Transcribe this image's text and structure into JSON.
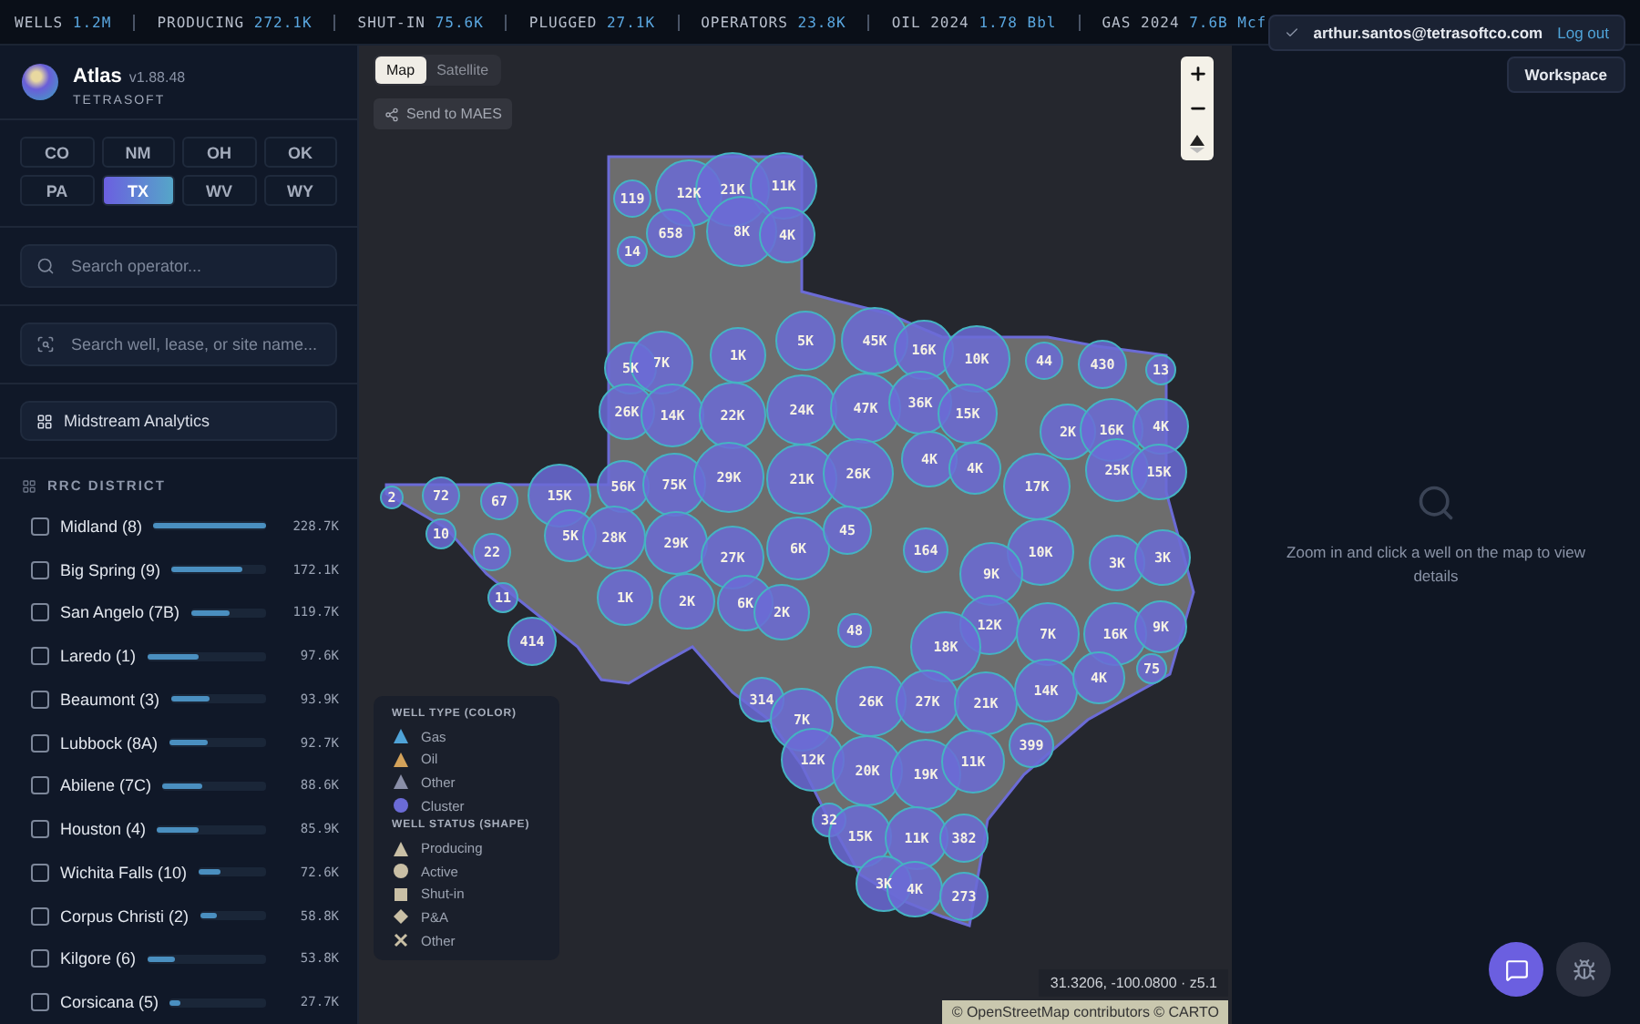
{
  "stats": [
    {
      "label": "WELLS",
      "value": "1.2M"
    },
    {
      "label": "PRODUCING",
      "value": "272.1K"
    },
    {
      "label": "SHUT-IN",
      "value": "75.6K"
    },
    {
      "label": "PLUGGED",
      "value": "27.1K"
    },
    {
      "label": "OPERATORS",
      "value": "23.8K"
    },
    {
      "label": "OIL 2024",
      "value": "1.78 Bbl"
    },
    {
      "label": "GAS 2024",
      "value": "7.6B Mcf"
    }
  ],
  "user": {
    "email": "arthur.santos@tetrasoftco.com",
    "logout": "Log out"
  },
  "workspace_button": "Workspace",
  "brand": {
    "name": "Atlas",
    "version": "v1.88.48",
    "company": "TETRASOFT"
  },
  "states": [
    {
      "label": "CO",
      "selected": false
    },
    {
      "label": "NM",
      "selected": false
    },
    {
      "label": "OH",
      "selected": false
    },
    {
      "label": "OK",
      "selected": false
    },
    {
      "label": "PA",
      "selected": false
    },
    {
      "label": "TX",
      "selected": true
    },
    {
      "label": "WV",
      "selected": false
    },
    {
      "label": "WY",
      "selected": false
    }
  ],
  "operator_search": {
    "placeholder": "Search operator..."
  },
  "site_search": {
    "placeholder": "Search well, lease, or site name..."
  },
  "midstream_button": "Midstream Analytics",
  "district_heading": "RRC DISTRICT",
  "districts": [
    {
      "name": "Midland (8)",
      "checked": false,
      "level": 1,
      "value": "228.7K"
    },
    {
      "name": "Big Spring (9)",
      "checked": false,
      "level": 0.75,
      "value": "172.1K"
    },
    {
      "name": "San Angelo (7B)",
      "checked": false,
      "level": 0.52,
      "value": "119.7K"
    },
    {
      "name": "Laredo (1)",
      "checked": false,
      "level": 0.43,
      "value": "97.6K"
    },
    {
      "name": "Beaumont (3)",
      "checked": false,
      "level": 0.41,
      "value": "93.9K"
    },
    {
      "name": "Lubbock (8A)",
      "checked": false,
      "level": 0.4,
      "value": "92.7K"
    },
    {
      "name": "Abilene (7C)",
      "checked": false,
      "level": 0.39,
      "value": "88.6K"
    },
    {
      "name": "Houston (4)",
      "checked": false,
      "level": 0.38,
      "value": "85.9K"
    },
    {
      "name": "Wichita Falls (10)",
      "checked": false,
      "level": 0.32,
      "value": "72.6K"
    },
    {
      "name": "Corpus Christi (2)",
      "checked": false,
      "level": 0.26,
      "value": "58.8K"
    },
    {
      "name": "Kilgore (6)",
      "checked": false,
      "level": 0.24,
      "value": "53.8K"
    },
    {
      "name": "Corsicana (5)",
      "checked": false,
      "level": 0.12,
      "value": "27.7K"
    }
  ],
  "map": {
    "view_modes": [
      {
        "label": "Map",
        "selected": true
      },
      {
        "label": "Satellite",
        "selected": false
      }
    ],
    "send_button": "Send to MAES",
    "clusters": [
      {
        "label": "119"
      },
      {
        "label": "12K"
      },
      {
        "label": "21K"
      },
      {
        "label": "11K"
      },
      {
        "label": "658"
      },
      {
        "label": "8K"
      },
      {
        "label": "4K"
      },
      {
        "label": "14"
      },
      {
        "label": "5K"
      },
      {
        "label": "7K"
      },
      {
        "label": "1K"
      },
      {
        "label": "5K"
      },
      {
        "label": "45K"
      },
      {
        "label": "16K"
      },
      {
        "label": "10K"
      },
      {
        "label": "44"
      },
      {
        "label": "430"
      },
      {
        "label": "13"
      },
      {
        "label": "26K"
      },
      {
        "label": "14K"
      },
      {
        "label": "22K"
      },
      {
        "label": "24K"
      },
      {
        "label": "47K"
      },
      {
        "label": "36K"
      },
      {
        "label": "15K"
      },
      {
        "label": "2K"
      },
      {
        "label": "16K"
      },
      {
        "label": "4K"
      },
      {
        "label": "56K"
      },
      {
        "label": "75K"
      },
      {
        "label": "29K"
      },
      {
        "label": "21K"
      },
      {
        "label": "26K"
      },
      {
        "label": "4K"
      },
      {
        "label": "4K"
      },
      {
        "label": "17K"
      },
      {
        "label": "25K"
      },
      {
        "label": "15K"
      },
      {
        "label": "2"
      },
      {
        "label": "72"
      },
      {
        "label": "67"
      },
      {
        "label": "15K"
      },
      {
        "label": "5K"
      },
      {
        "label": "28K"
      },
      {
        "label": "29K"
      },
      {
        "label": "27K"
      },
      {
        "label": "6K"
      },
      {
        "label": "45"
      },
      {
        "label": "164"
      },
      {
        "label": "10K"
      },
      {
        "label": "3K"
      },
      {
        "label": "3K"
      },
      {
        "label": "10"
      },
      {
        "label": "22"
      },
      {
        "label": "11"
      },
      {
        "label": "414"
      },
      {
        "label": "1K"
      },
      {
        "label": "2K"
      },
      {
        "label": "6K"
      },
      {
        "label": "2K"
      },
      {
        "label": "48"
      },
      {
        "label": "9K"
      },
      {
        "label": "12K"
      },
      {
        "label": "18K"
      },
      {
        "label": "7K"
      },
      {
        "label": "16K"
      },
      {
        "label": "9K"
      },
      {
        "label": "75"
      },
      {
        "label": "314"
      },
      {
        "label": "7K"
      },
      {
        "label": "26K"
      },
      {
        "label": "27K"
      },
      {
        "label": "21K"
      },
      {
        "label": "14K"
      },
      {
        "label": "4K"
      },
      {
        "label": "12K"
      },
      {
        "label": "20K"
      },
      {
        "label": "19K"
      },
      {
        "label": "11K"
      },
      {
        "label": "399"
      },
      {
        "label": "32"
      },
      {
        "label": "15K"
      },
      {
        "label": "11K"
      },
      {
        "label": "382"
      },
      {
        "label": "3K"
      },
      {
        "label": "4K"
      },
      {
        "label": "273"
      }
    ],
    "coordinates": "31.3206, -100.0800 · z5.1",
    "attribution": "© OpenStreetMap contributors © CARTO"
  },
  "legend": {
    "type_heading": "WELL TYPE (COLOR)",
    "types": [
      {
        "label": "Gas",
        "kind": "triangle",
        "color": "#4fa3d8"
      },
      {
        "label": "Oil",
        "kind": "triangle",
        "color": "#d4a25a"
      },
      {
        "label": "Other",
        "kind": "triangle",
        "color": "#8a8fa8"
      },
      {
        "label": "Cluster",
        "kind": "circle",
        "color": "#6b6bd6"
      }
    ],
    "status_heading": "WELL STATUS (SHAPE)",
    "statuses": [
      {
        "label": "Producing",
        "kind": "triangle"
      },
      {
        "label": "Active",
        "kind": "circle"
      },
      {
        "label": "Shut-in",
        "kind": "square"
      },
      {
        "label": "P&A",
        "kind": "diamond"
      },
      {
        "label": "Other",
        "kind": "cross"
      }
    ]
  },
  "details": {
    "message": "Zoom in and click a well on the map to view details"
  }
}
